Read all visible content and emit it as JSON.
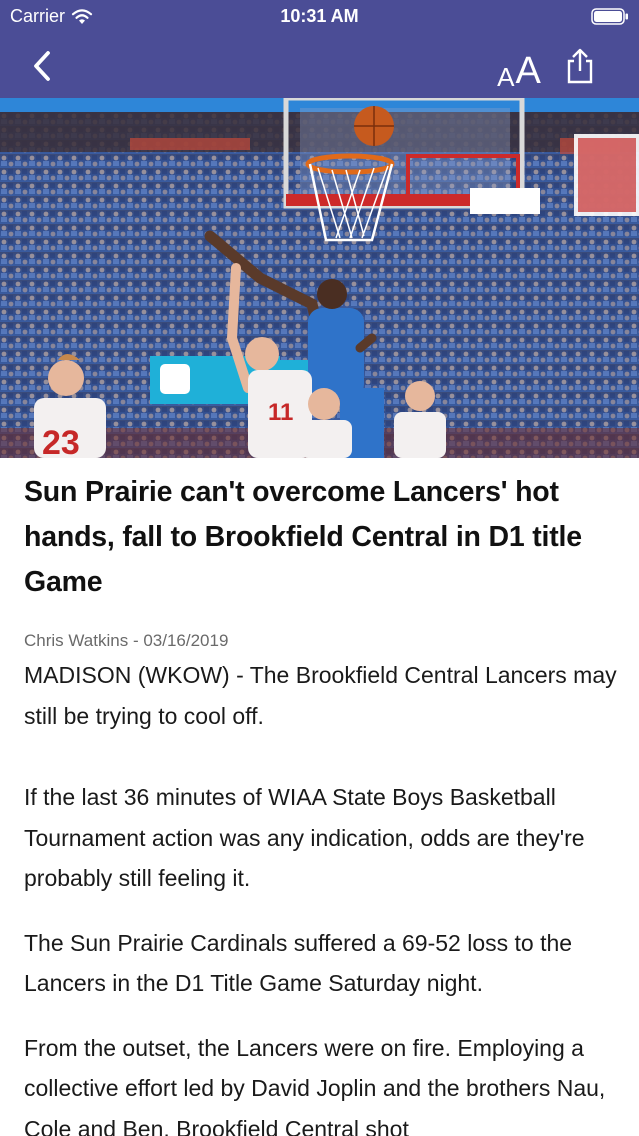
{
  "status_bar": {
    "carrier": "Carrier",
    "time": "10:31 AM",
    "icons": [
      "wifi-icon",
      "battery-icon"
    ]
  },
  "nav_bar": {
    "background": "#4b4d96",
    "back_icon": "chevron-left-icon",
    "font_size_label_small": "A",
    "font_size_label_large": "A",
    "share_icon": "share-icon"
  },
  "hero_image": {
    "description_icon": "basketball-photo",
    "jersey_numbers": [
      "23",
      "11"
    ]
  },
  "article": {
    "headline": "Sun Prairie can't overcome Lancers' hot hands, fall to Brookfield Central in D1 title Game",
    "byline": "Chris Watkins - 03/16/2019",
    "paragraphs": [
      "MADISON (WKOW) - The Brookfield Central Lancers may still be trying to cool off.",
      "If the last 36 minutes of WIAA State Boys Basketball Tournament action was any indication, odds are they're probably still feeling it.",
      "The Sun Prairie Cardinals suffered a 69-52 loss to the Lancers in the D1 Title Game Saturday night.",
      "From the outset, the Lancers were on fire. Employing a collective effort led by David Joplin and the brothers Nau, Cole and Ben, Brookfield Central shot"
    ]
  }
}
